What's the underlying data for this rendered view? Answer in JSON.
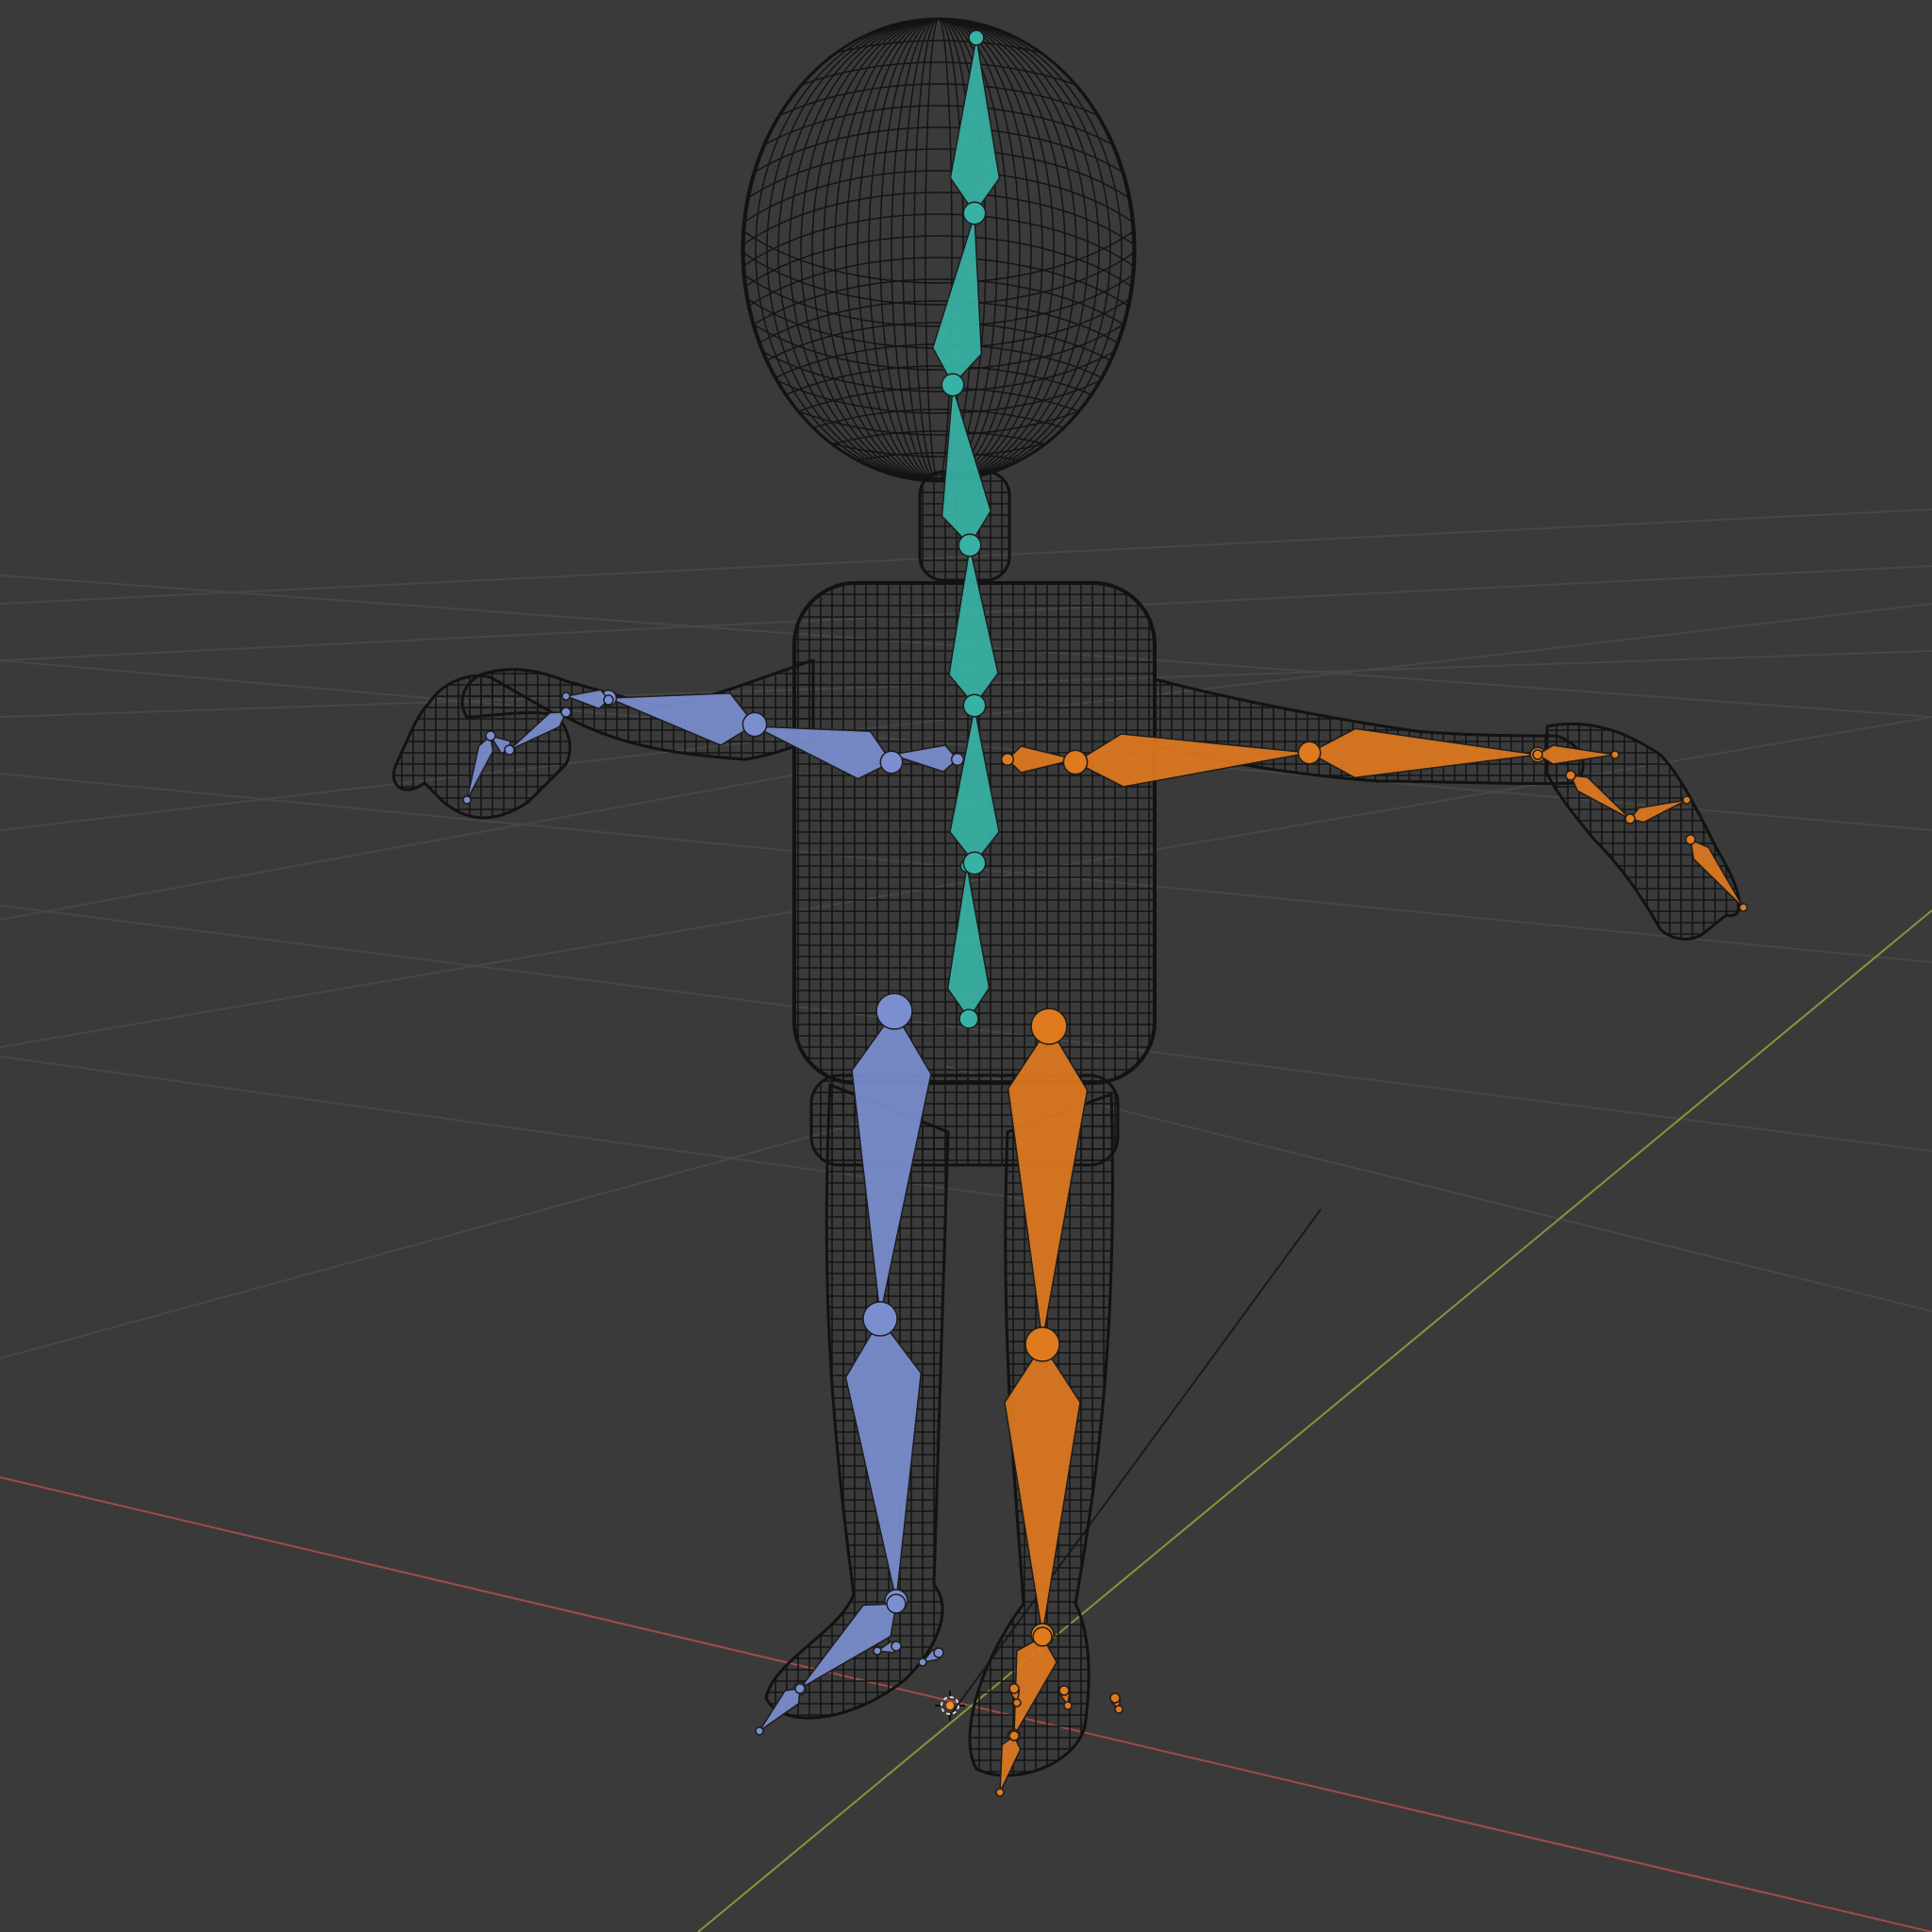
{
  "viewport": {
    "background": "#3a3a3a",
    "grid_color": "#474747",
    "x_axis_color": "#a34a4a",
    "y_axis_color": "#7d9a38",
    "wire_color": "#101010"
  },
  "armature": {
    "spine_color": "#37b3a6",
    "left_color": "#7b8fd0",
    "right_color": "#e07a1f",
    "selected_outline": "#f0a050"
  },
  "origin_marker": "origin-icon"
}
